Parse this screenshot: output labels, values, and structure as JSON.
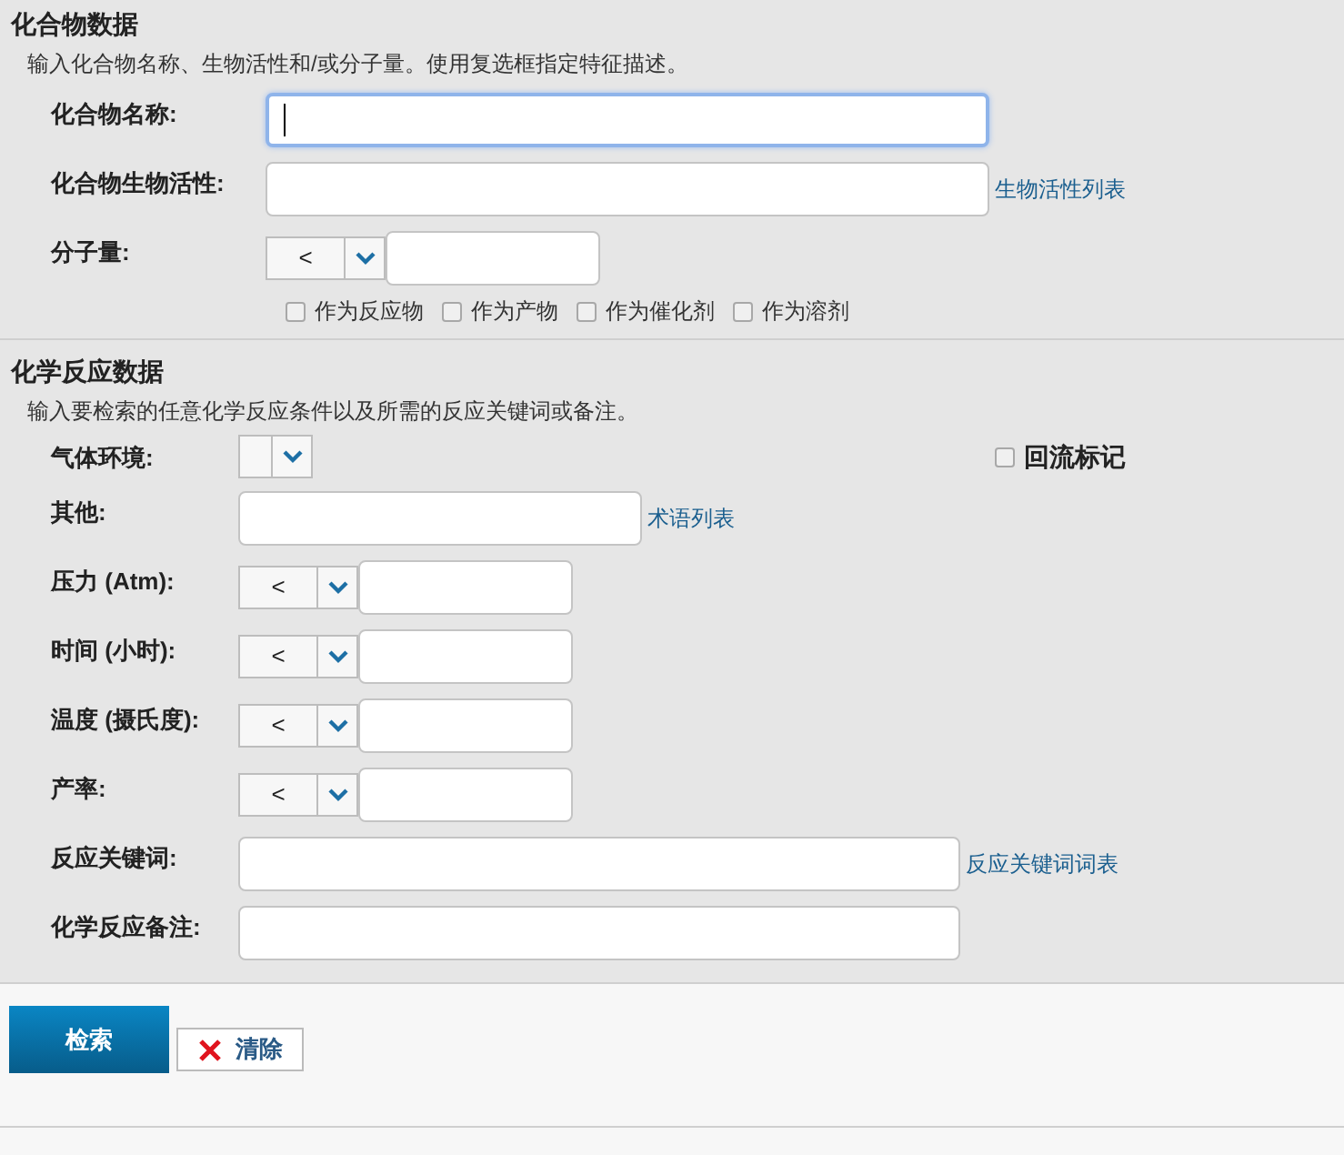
{
  "compound_section": {
    "title": "化合物数据",
    "description": "输入化合物名称、生物活性和/或分子量。使用复选框指定特征描述。",
    "fields": [
      {
        "kind": "text",
        "label": "化合物名称:",
        "focused": true
      },
      {
        "kind": "text",
        "label": "化合物生物活性:",
        "focused": false,
        "link": "生物活性列表"
      },
      {
        "kind": "range",
        "label": "分子量:",
        "operator": "<"
      }
    ],
    "checkboxes": [
      {
        "label": "作为反应物",
        "checked": false
      },
      {
        "label": "作为产物",
        "checked": false
      },
      {
        "label": "作为催化剂",
        "checked": false
      },
      {
        "label": "作为溶剂",
        "checked": false
      }
    ]
  },
  "reaction_section": {
    "title": "化学反应数据",
    "description": "输入要检索的任意化学反应条件以及所需的反应关键词或备注。",
    "fields": [
      {
        "kind": "select",
        "label": "气体环境:",
        "side_checkbox": {
          "label": "回流标记",
          "checked": false
        }
      },
      {
        "kind": "short_text",
        "label": "其他:",
        "focused": false,
        "link": "术语列表"
      },
      {
        "kind": "range",
        "label": "压力 (Atm):",
        "operator": "<"
      },
      {
        "kind": "range",
        "label": "时间 (小时):",
        "operator": "<"
      },
      {
        "kind": "range",
        "label": "温度 (摄氏度):",
        "operator": "<"
      },
      {
        "kind": "range",
        "label": "产率:",
        "operator": "<"
      },
      {
        "kind": "text",
        "label": "反应关键词:",
        "focused": false,
        "link": "反应关键词词表"
      },
      {
        "kind": "text",
        "label": "化学反应备注:",
        "focused": false
      }
    ]
  },
  "buttons": [
    {
      "kind": "primary",
      "label": "检索"
    },
    {
      "kind": "clear",
      "label": "清除"
    }
  ]
}
